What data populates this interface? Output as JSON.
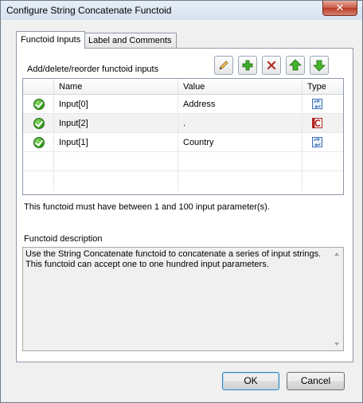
{
  "window": {
    "title": "Configure String Concatenate Functoid",
    "close_glyph": "✕"
  },
  "tabs": [
    {
      "label": "Functoid Inputs",
      "active": true
    },
    {
      "label": "Label and Comments",
      "active": false
    }
  ],
  "inputs_panel": {
    "instructions": "Add/delete/reorder functoid inputs",
    "toolbar": [
      {
        "icon": "pencil-icon",
        "tooltip": ""
      },
      {
        "icon": "add-plus-icon"
      },
      {
        "icon": "delete-x-icon"
      },
      {
        "icon": "move-up-arrow-icon"
      },
      {
        "icon": "move-down-arrow-icon"
      }
    ],
    "columns": [
      "Name",
      "Value",
      "Type"
    ],
    "rows": [
      {
        "status_icon": "green-check-icon",
        "name": "Input[0]",
        "value": "Address",
        "type_icon": "link-link-icon"
      },
      {
        "status_icon": "green-check-icon",
        "name": "Input[2]",
        "value": ".",
        "type_icon": "constant-c-icon"
      },
      {
        "status_icon": "green-check-icon",
        "name": "Input[1]",
        "value": "Country",
        "type_icon": "link-link-icon"
      }
    ],
    "limit_text": "This functoid must have between 1 and 100 input parameter(s).",
    "description_label": "Functoid description",
    "description": "Use the String Concatenate functoid to concatenate a series of input strings.\nThis functoid can accept one to one hundred input parameters."
  },
  "buttons": {
    "ok": "OK",
    "cancel": "Cancel"
  },
  "colors": {
    "accent_green": "#2f9a1b",
    "delete_red": "#c0392b",
    "constant_red": "#b22222"
  }
}
